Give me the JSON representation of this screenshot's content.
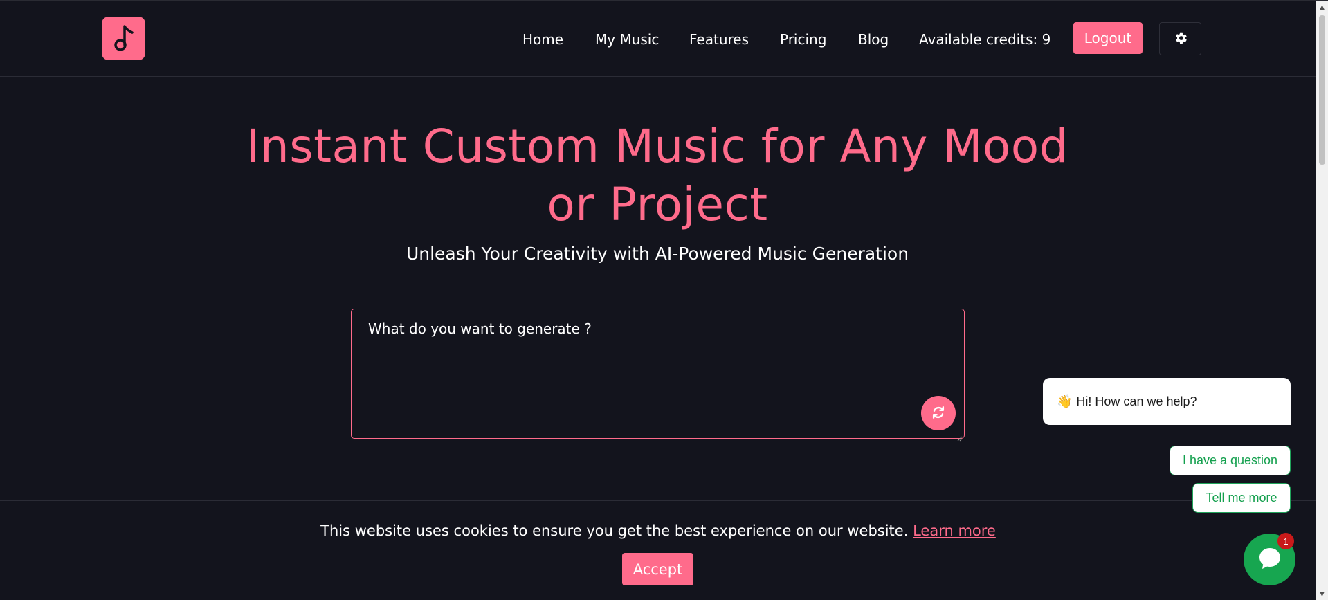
{
  "header": {
    "logo_icon": "music-note-icon",
    "nav": [
      {
        "label": "Home"
      },
      {
        "label": "My Music"
      },
      {
        "label": "Features"
      },
      {
        "label": "Pricing"
      },
      {
        "label": "Blog"
      }
    ],
    "credits_label": "Available credits: 9",
    "logout_label": "Logout",
    "theme_icon": "gear-icon"
  },
  "hero": {
    "title_line1": "Instant Custom Music for Any Mood",
    "title_line2": "or Project",
    "subtitle": "Unleash Your Creativity with AI-Powered Music Generation"
  },
  "prompt": {
    "placeholder": "What do you want to generate ?",
    "regenerate_icon": "refresh-icon"
  },
  "cookie": {
    "text": "This website uses cookies to ensure you get the best experience on our website.",
    "link": "Learn more",
    "accept_label": "Accept"
  },
  "chat": {
    "greeting": "Hi! How can we help?",
    "greeting_emoji": "👋",
    "options": [
      "I have a question",
      "Tell me more"
    ],
    "badge_count": "1"
  },
  "colors": {
    "background": "#13141d",
    "accent": "#ff6b8b",
    "chat_green": "#17a650",
    "badge_red": "#c91a1a"
  }
}
